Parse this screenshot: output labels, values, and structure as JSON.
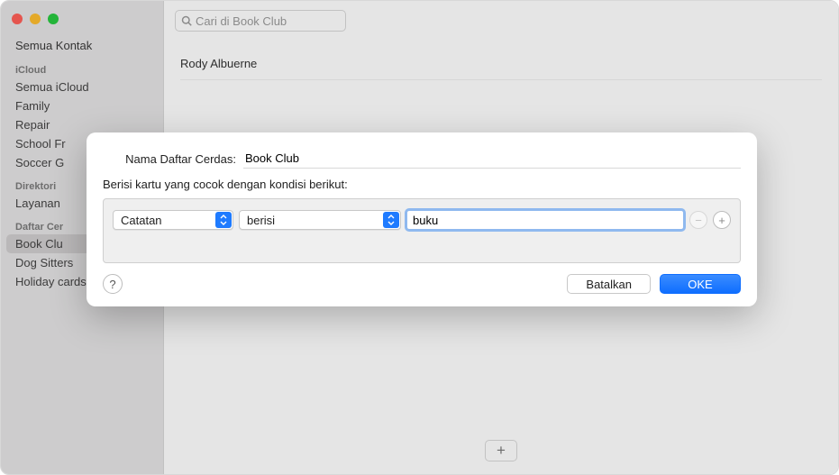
{
  "sidebar": {
    "top_item": "Semua Kontak",
    "sections": [
      {
        "title": "iCloud",
        "items": [
          "Semua iCloud",
          "Family",
          "Repair",
          "School Fr",
          "Soccer G"
        ]
      },
      {
        "title": "Direktori",
        "items": [
          "Layanan "
        ]
      },
      {
        "title": "Daftar Cer",
        "items": [
          "Book Clu",
          "Dog Sitters",
          "Holiday cards"
        ],
        "selected_index": 0
      }
    ]
  },
  "search": {
    "placeholder": "Cari di Book Club"
  },
  "contacts": {
    "items": [
      "Rody Albuerne"
    ]
  },
  "sheet": {
    "name_label": "Nama Daftar Cerdas:",
    "name_value": "Book Club",
    "condition_label": "Berisi kartu yang cocok dengan kondisi berikut:",
    "rule": {
      "field": "Catatan",
      "operator": "berisi",
      "value": "buku"
    },
    "cancel": "Batalkan",
    "ok": "OKE",
    "help": "?"
  },
  "icons": {
    "minus": "−",
    "plus": "+"
  }
}
